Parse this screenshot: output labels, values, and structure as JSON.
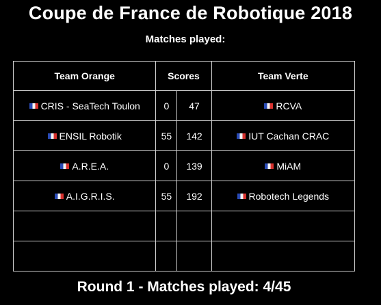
{
  "title": "Coupe de France de Robotique 2018",
  "subtitle": "Matches played:",
  "table": {
    "headers": {
      "team_orange": "Team Orange",
      "scores": "Scores",
      "team_verte": "Team Verte"
    },
    "rows": [
      {
        "orange": "CRIS - SeaTech Toulon",
        "score_orange": "0",
        "score_verte": "47",
        "verte": "RCVA"
      },
      {
        "orange": "ENSIL Robotik",
        "score_orange": "55",
        "score_verte": "142",
        "verte": "IUT Cachan CRAC"
      },
      {
        "orange": "A.R.E.A.",
        "score_orange": "0",
        "score_verte": "139",
        "verte": "MiAM"
      },
      {
        "orange": "A.I.G.R.I.S.",
        "score_orange": "55",
        "score_verte": "192",
        "verte": "Robotech Legends"
      },
      {
        "orange": "",
        "score_orange": "",
        "score_verte": "",
        "verte": ""
      },
      {
        "orange": "",
        "score_orange": "",
        "score_verte": "",
        "verte": ""
      }
    ]
  },
  "flag_icon": "french-flag-icon",
  "colors": {
    "background": "#000000",
    "text": "#ffffff",
    "grid": "#cfcfcf",
    "flag_blue": "#2a4bb5",
    "flag_white": "#f4f4f4",
    "flag_red": "#d8322f"
  },
  "footer": "Round 1 - Matches played: 4/45"
}
